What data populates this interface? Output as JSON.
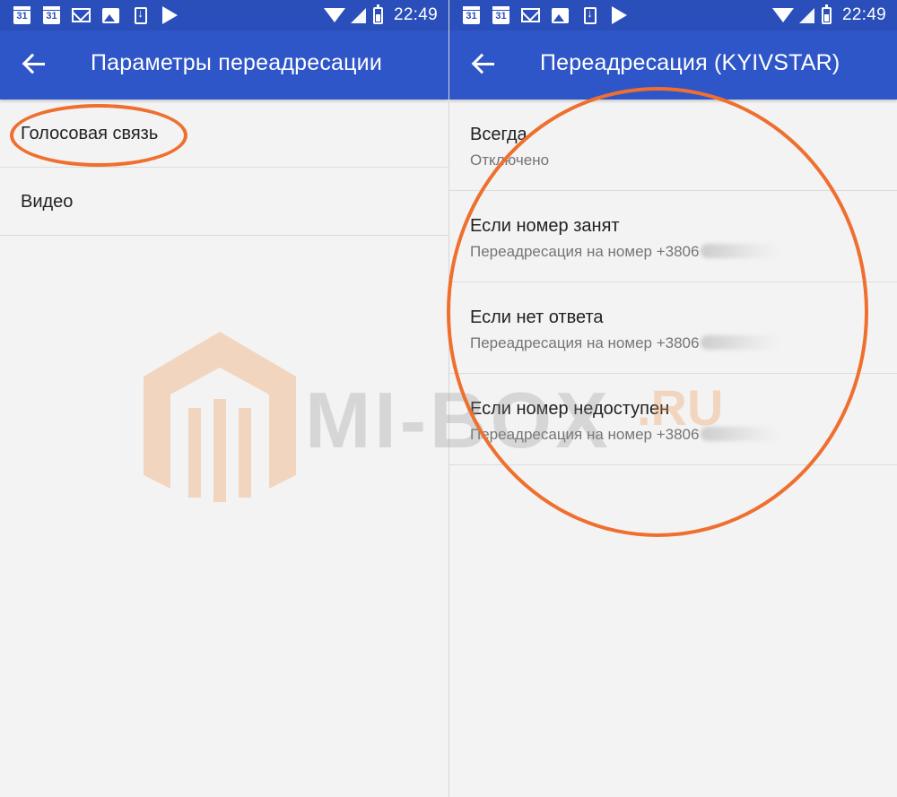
{
  "status_bar": {
    "time": "22:49",
    "calendar_days": [
      "31",
      "31"
    ],
    "icons": [
      "calendar-icon",
      "calendar-icon",
      "gmail-icon",
      "photos-icon",
      "download-icon",
      "play-store-icon",
      "wifi-icon",
      "signal-icon",
      "battery-icon"
    ]
  },
  "left_screen": {
    "title": "Параметры переадресации",
    "items": [
      {
        "label": "Голосовая связь"
      },
      {
        "label": "Видео"
      }
    ]
  },
  "right_screen": {
    "title": "Переадресация (KYIVSTAR)",
    "items": [
      {
        "label": "Всегда",
        "sub": "Отключено"
      },
      {
        "label": "Если номер занят",
        "sub": "Переадресация на номер +3806"
      },
      {
        "label": "Если нет ответа",
        "sub": "Переадресация на номер +3806"
      },
      {
        "label": "Если номер недоступен",
        "sub": "Переадресация на номер +3806"
      }
    ]
  },
  "watermark": {
    "text": "MI-BOX",
    "suffix": ".RU"
  },
  "colors": {
    "status_bar": "#2a4fba",
    "app_bar": "#2f56c8",
    "background": "#f3f3f3",
    "highlight": "#ef6f2f"
  }
}
